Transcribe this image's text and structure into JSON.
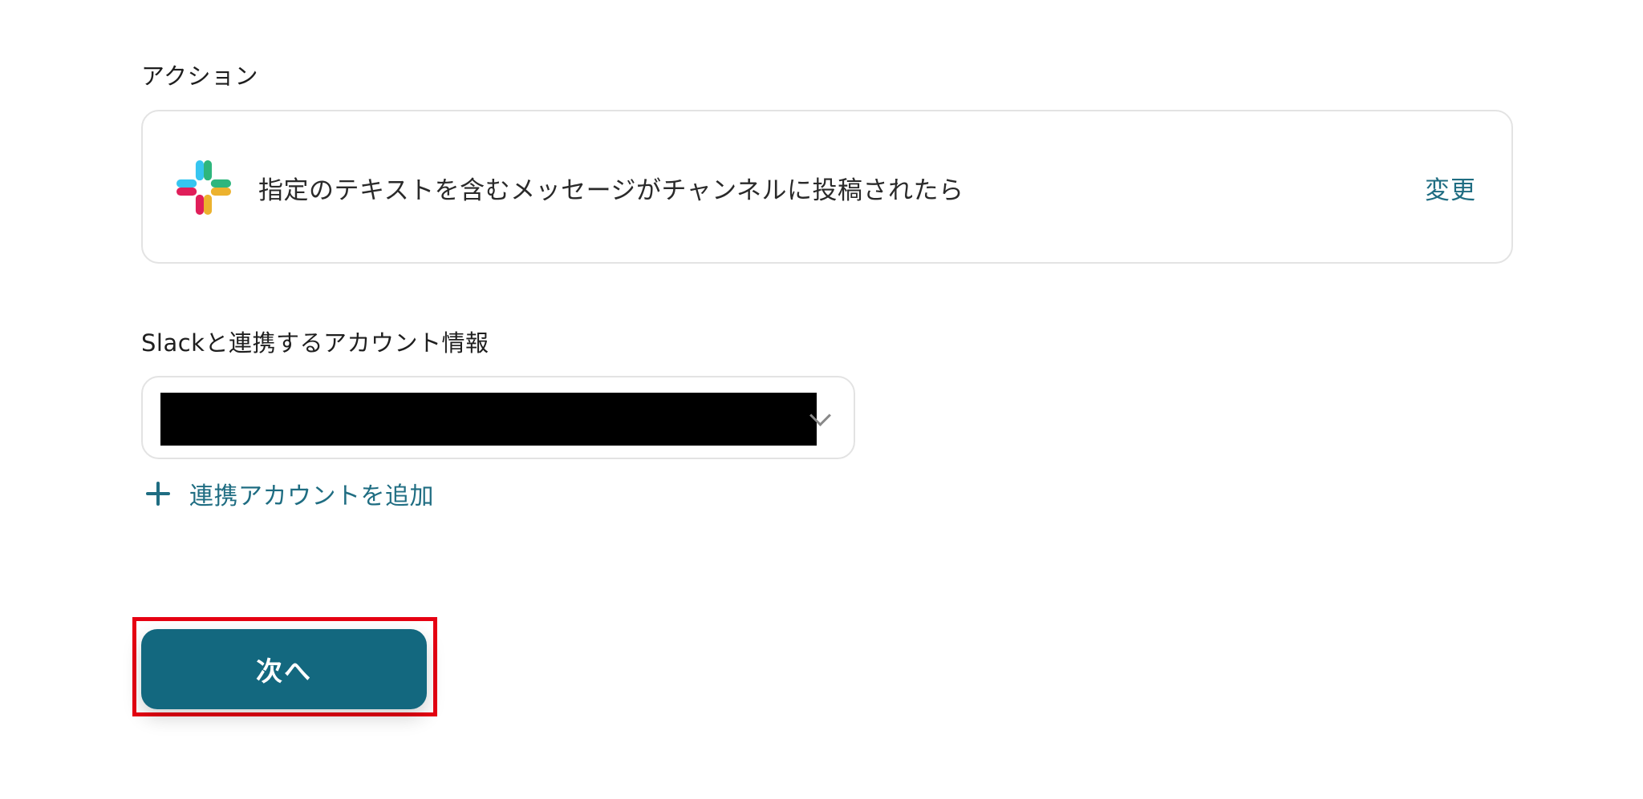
{
  "action_section": {
    "label": "アクション",
    "card": {
      "icon": "slack-logo",
      "text": "指定のテキストを含むメッセージがチャンネルに投稿されたら",
      "change_label": "変更"
    }
  },
  "account_section": {
    "label": "Slackと連携するアカウント情報",
    "select_value": "",
    "add_account_label": "連携アカウントを追加"
  },
  "next_button": {
    "label": "次へ"
  },
  "colors": {
    "accent": "#1f6d82",
    "button": "#13687f",
    "highlight": "#e60012",
    "slack_blue": "#36c5f0",
    "slack_green": "#2eb67d",
    "slack_red": "#e01e5a",
    "slack_yellow": "#ecb22e"
  }
}
